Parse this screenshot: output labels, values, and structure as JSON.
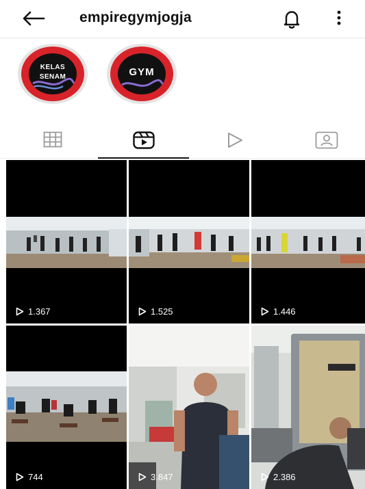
{
  "header": {
    "title": "empiregymjogja"
  },
  "highlights": [
    {
      "line1": "KELAS",
      "line2": "SENAM"
    },
    {
      "line1": "GYM"
    }
  ],
  "tabs": [
    {
      "name": "grid",
      "active": false
    },
    {
      "name": "reels",
      "active": true
    },
    {
      "name": "video",
      "active": false
    },
    {
      "name": "tagged",
      "active": false
    }
  ],
  "reels": [
    {
      "views": "1.367"
    },
    {
      "views": "1.525"
    },
    {
      "views": "1.446"
    },
    {
      "views": "744"
    },
    {
      "views": "3.847"
    },
    {
      "views": "2.386"
    }
  ]
}
